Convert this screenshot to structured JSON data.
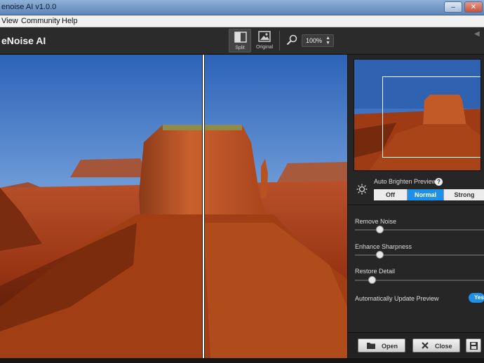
{
  "window": {
    "title": "enoise AI v1.0.0",
    "min": "–",
    "close": "✕"
  },
  "menu": [
    "View",
    "Community",
    "Help"
  ],
  "toolbar": {
    "app_name": "eNoise AI",
    "split_label": "Split",
    "original_label": "Original",
    "zoom_value": "100%"
  },
  "panel": {
    "auto_brighten_label": "Auto Brighten Preview",
    "help": "?",
    "brighten_options": [
      "Off",
      "Normal",
      "Strong"
    ],
    "brighten_selected": "Normal",
    "sliders": [
      {
        "label": "Remove Noise",
        "value": 0.19
      },
      {
        "label": "Enhance Sharpness",
        "value": 0.19
      },
      {
        "label": "Restore Detail",
        "value": 0.13
      }
    ],
    "auto_update_label": "Automatically Update Preview",
    "auto_update_toggle": "Yes",
    "open_label": "Open",
    "close_label": "Close"
  },
  "colors": {
    "accent": "#1e90e8",
    "panel_bg": "#262626",
    "toolbar_bg": "#2b2b2b"
  }
}
